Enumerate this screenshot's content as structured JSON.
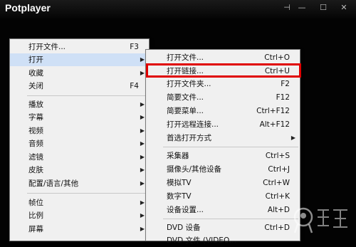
{
  "app": {
    "title": "Potplayer"
  },
  "window_controls": [
    {
      "name": "pin-icon",
      "glyph": "⊣"
    },
    {
      "name": "minimize-icon",
      "glyph": "—"
    },
    {
      "name": "maximize-icon",
      "glyph": "☐"
    },
    {
      "name": "close-icon",
      "glyph": "✕"
    }
  ],
  "main_menu": {
    "items": [
      {
        "label": "打开文件...",
        "shortcut": "F3",
        "submenu": false
      },
      {
        "label": "打开",
        "shortcut": "",
        "submenu": true,
        "highlighted": true
      },
      {
        "label": "收藏",
        "shortcut": "",
        "submenu": true
      },
      {
        "label": "关闭",
        "shortcut": "F4",
        "submenu": false
      },
      {
        "label": "播放",
        "shortcut": "",
        "submenu": true
      },
      {
        "label": "字幕",
        "shortcut": "",
        "submenu": true
      },
      {
        "label": "视频",
        "shortcut": "",
        "submenu": true
      },
      {
        "label": "音频",
        "shortcut": "",
        "submenu": true
      },
      {
        "label": "滤镜",
        "shortcut": "",
        "submenu": true
      },
      {
        "label": "皮肤",
        "shortcut": "",
        "submenu": true
      },
      {
        "label": "配置/语言/其他",
        "shortcut": "",
        "submenu": true
      },
      {
        "label": "帧位",
        "shortcut": "",
        "submenu": true
      },
      {
        "label": "比例",
        "shortcut": "",
        "submenu": true
      },
      {
        "label": "屏幕",
        "shortcut": "",
        "submenu": true
      }
    ]
  },
  "open_submenu": {
    "items": [
      {
        "label": "打开文件...",
        "shortcut": "Ctrl+O"
      },
      {
        "label": "打开链接...",
        "shortcut": "Ctrl+U",
        "highlighted": true
      },
      {
        "label": "打开文件夹...",
        "shortcut": "F2"
      },
      {
        "label": "简要文件...",
        "shortcut": "F12"
      },
      {
        "label": "简要菜单...",
        "shortcut": "Ctrl+F12"
      },
      {
        "label": "打开远程连接...",
        "shortcut": "Alt+F12"
      },
      {
        "label": "首选打开方式",
        "shortcut": "",
        "submenu": true
      },
      {
        "label": "采集器",
        "shortcut": "Ctrl+S"
      },
      {
        "label": "摄像头/其他设备",
        "shortcut": "Ctrl+J"
      },
      {
        "label": "模拟TV",
        "shortcut": "Ctrl+W"
      },
      {
        "label": "数字TV",
        "shortcut": "Ctrl+K"
      },
      {
        "label": "设备设置...",
        "shortcut": "Alt+D"
      },
      {
        "label": "DVD 设备",
        "shortcut": "Ctrl+D"
      },
      {
        "label": "DVD 文件 (VIDEO...",
        "shortcut": ""
      }
    ]
  },
  "colors": {
    "highlight": "#cfe0f6",
    "annotation_box": "#e00000",
    "menu_bg": "#f0f0f0"
  }
}
